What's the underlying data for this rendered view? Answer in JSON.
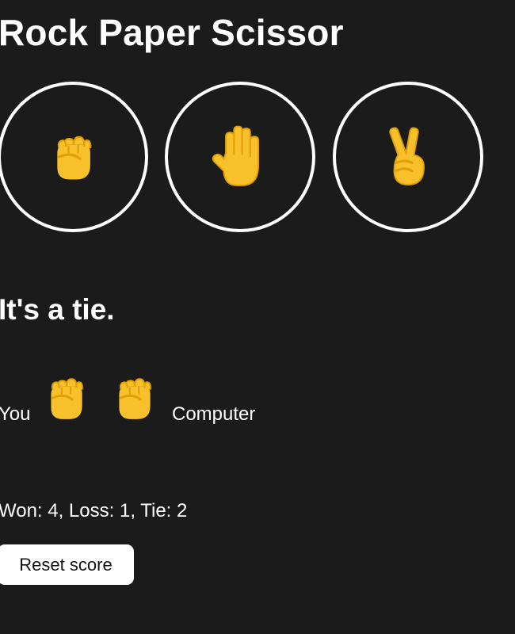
{
  "app": {
    "title": "Rock Paper Scissor"
  },
  "choices": [
    {
      "name": "rock",
      "icon": "raised-fist-icon"
    },
    {
      "name": "paper",
      "icon": "raised-hand-icon"
    },
    {
      "name": "scissors",
      "icon": "victory-hand-icon"
    }
  ],
  "result": {
    "text": "It's a tie."
  },
  "moves": {
    "you_label": "You",
    "you_icon": "raised-fist-icon",
    "computer_label": "Computer",
    "computer_icon": "raised-fist-icon"
  },
  "score": {
    "text": "Won: 4, Loss: 1, Tie: 2"
  },
  "reset_button": {
    "label": "Reset score"
  },
  "colors": {
    "background": "#1b1b1b",
    "emoji_yellow": "#f8c02a",
    "emoji_shade": "#e2a006",
    "button_bg": "#ffffff"
  }
}
